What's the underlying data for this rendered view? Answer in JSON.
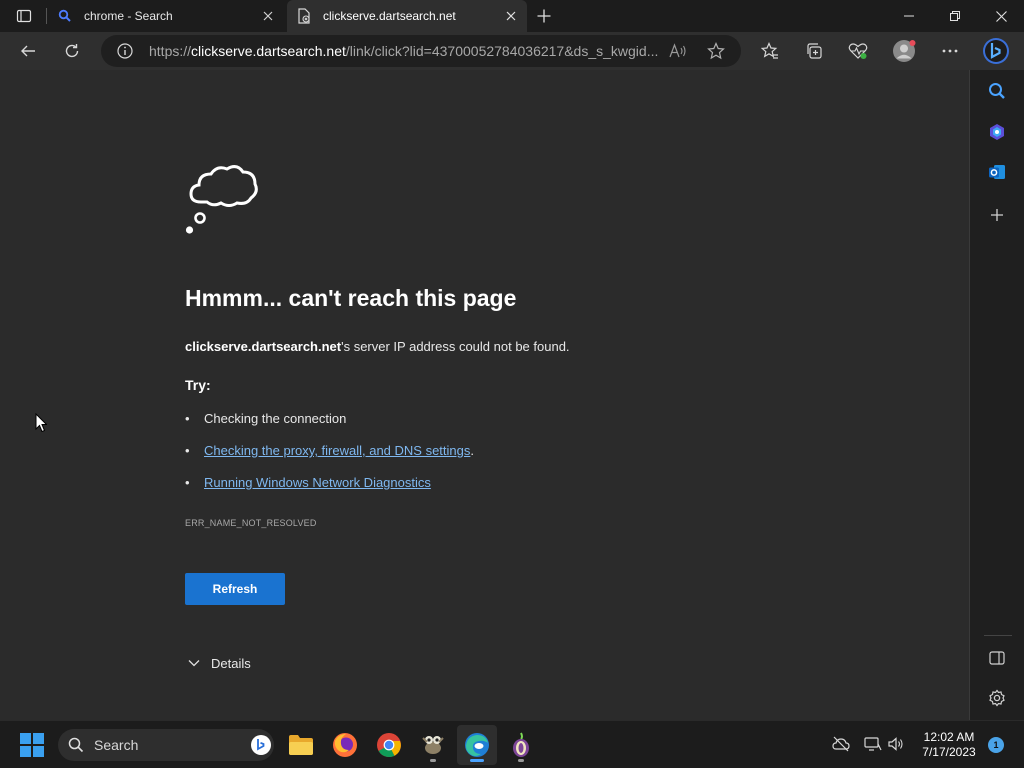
{
  "browser": {
    "tabs": [
      {
        "title": "chrome - Search",
        "active": false,
        "icon": "search-icon"
      },
      {
        "title": "clickserve.dartsearch.net",
        "active": true,
        "icon": "broken-page-icon"
      }
    ],
    "new_tab_icon": "plus-icon",
    "window_controls": [
      "minimize-icon",
      "restore-icon",
      "close-icon"
    ],
    "address": {
      "url_prefix": "https://",
      "url_host": "clickserve.dartsearch.net",
      "url_rest": "/link/click?lid=43700052784036217&ds_s_kwgid..."
    },
    "toolbar_icons": [
      "back-icon",
      "refresh-icon",
      "info-icon",
      "read-aloud-icon",
      "favorite-star-icon",
      "favorites-icon",
      "collections-icon",
      "health-icon",
      "profile-avatar",
      "more-icon",
      "bing-copilot-icon"
    ]
  },
  "error_page": {
    "title": "Hmmm... can't reach this page",
    "host": "clickserve.dartsearch.net",
    "description_rest": "'s server IP address could not be found.",
    "try_label": "Try:",
    "suggestions": [
      {
        "text": "Checking the connection",
        "link": false,
        "suffix": ""
      },
      {
        "text": "Checking the proxy, firewall, and DNS settings",
        "link": true,
        "suffix": "."
      },
      {
        "text": "Running Windows Network Diagnostics",
        "link": true,
        "suffix": ""
      }
    ],
    "bullet": "•",
    "error_code": "ERR_NAME_NOT_RESOLVED",
    "refresh_label": "Refresh",
    "details_label": "Details"
  },
  "sidebar_icons": [
    "search-icon",
    "copilot-icon",
    "outlook-icon",
    "add-icon",
    "hide-sidebar-icon",
    "settings-icon"
  ],
  "taskbar": {
    "search_label": "Search",
    "apps": [
      "file-explorer-icon",
      "firefox-icon",
      "chrome-icon",
      "gimp-icon",
      "edge-icon",
      "tor-icon"
    ],
    "time": "12:02 AM",
    "date": "7/17/2023",
    "notification_count": "1"
  },
  "colors": {
    "page_bg": "#2b2b2b",
    "link": "#7fb8f0",
    "refresh_button": "#1a73d0"
  }
}
